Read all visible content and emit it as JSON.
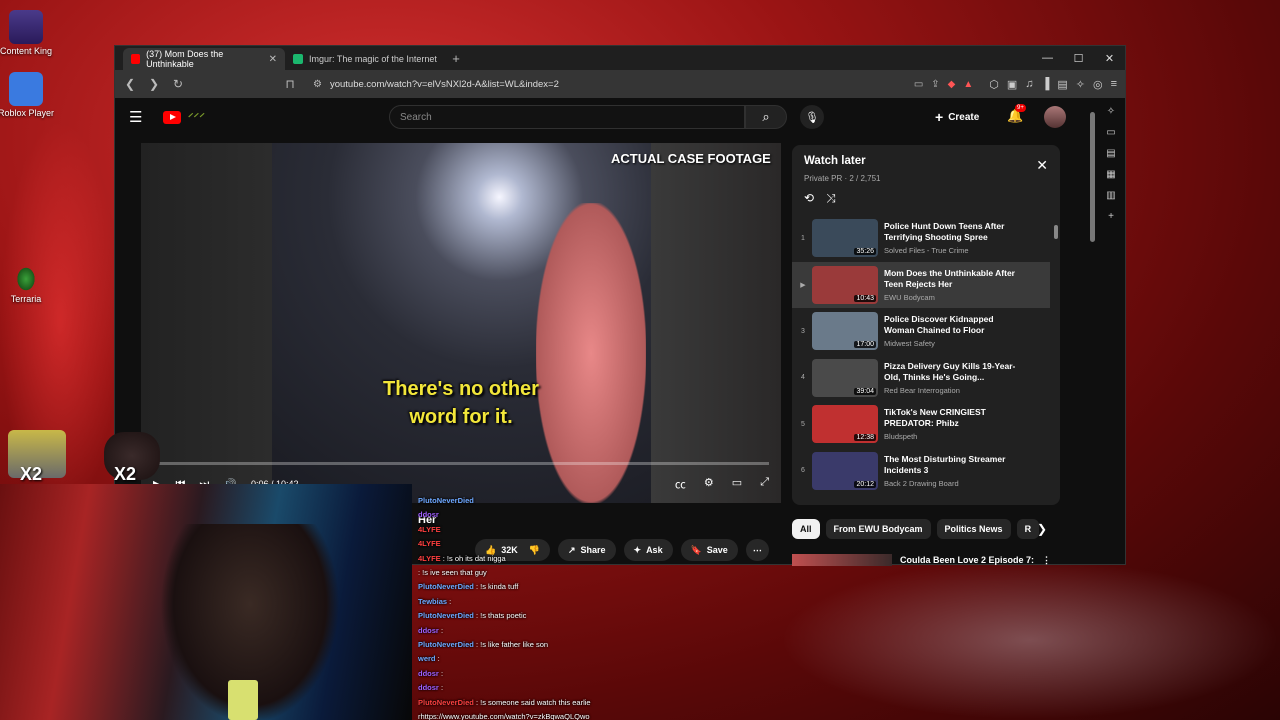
{
  "desktop": {
    "icons": [
      {
        "label": "Content King"
      },
      {
        "label": "Roblox Player"
      },
      {
        "label": "Terraria"
      }
    ]
  },
  "browser": {
    "tabs": [
      {
        "label": "(37) Mom Does the Unthinkable",
        "active": true
      },
      {
        "label": "Imgur: The magic of the Internet",
        "active": false
      }
    ],
    "url": "youtube.com/watch?v=elVsNXl2d-A&list=WL&index=2"
  },
  "youtube": {
    "search_placeholder": "Search",
    "create_label": "Create",
    "notif_count": "9+",
    "video": {
      "caption_line1": "There's no other",
      "caption_line2": "word for it.",
      "top_banner": "ACTUAL CASE FOOTAGE",
      "time": "0:06 / 10:42",
      "progress": 0.01
    },
    "actions": {
      "likes": "32K",
      "share": "Share",
      "ask": "Ask",
      "save": "Save"
    },
    "watch_later": {
      "title": "Watch later",
      "subtitle": "Private PR · 2 / 2,751",
      "items": [
        {
          "num": "1",
          "title": "Police Hunt Down Teens After Terrifying Shooting Spree",
          "channel": "Solved Files - True Crime",
          "duration": "35:26",
          "thumb": "#3a4a5a"
        },
        {
          "num": "▶",
          "title": "Mom Does the Unthinkable After Teen Rejects Her",
          "channel": "EWU Bodycam",
          "duration": "10:43",
          "thumb": "#9a3a3a"
        },
        {
          "num": "3",
          "title": "Police Discover Kidnapped Woman Chained to Floor",
          "channel": "Midwest Safety",
          "duration": "17:00",
          "thumb": "#6a7a8a"
        },
        {
          "num": "4",
          "title": "Pizza Delivery Guy Kills 19-Year-Old, Thinks He's Going...",
          "channel": "Red Bear Interrogation",
          "duration": "39:04",
          "thumb": "#4a4a4a"
        },
        {
          "num": "5",
          "title": "TikTok's New CRINGIEST PREDATOR: Phibz",
          "channel": "Bludspeth",
          "duration": "12:38",
          "thumb": "#c03030"
        },
        {
          "num": "6",
          "title": "The Most Disturbing Streamer Incidents 3",
          "channel": "Back 2 Drawing Board",
          "duration": "20:12",
          "thumb": "#3a3a6a"
        }
      ]
    },
    "chips": [
      "All",
      "From EWU Bodycam",
      "Politics News",
      "R"
    ],
    "next_video_title": "Coulda Been Love 2 Episode 7:"
  },
  "overlay": {
    "x2_left": "X2",
    "x2_right": "X2",
    "her_text": "Her"
  },
  "chat": [
    {
      "user": "PlutoNeverDied",
      "cls": "",
      "msg": ""
    },
    {
      "user": "ddosr",
      "cls": "purple",
      "msg": ""
    },
    {
      "user": "4LYFE",
      "cls": "red",
      "msg": ""
    },
    {
      "user": "4LYFE",
      "cls": "red",
      "msg": ""
    },
    {
      "user": "4LYFE",
      "cls": "red",
      "msg": ": !s oh its dat nigga"
    },
    {
      "user": "",
      "cls": "red",
      "msg": ": !s ive seen that guy"
    },
    {
      "user": "PlutoNeverDied",
      "cls": "",
      "msg": ": !s kinda tuff"
    },
    {
      "user": "Tewbias",
      "cls": "",
      "msg": ":"
    },
    {
      "user": "PlutoNeverDied",
      "cls": "",
      "msg": ": !s thats poetic"
    },
    {
      "user": "ddosr",
      "cls": "purple",
      "msg": ":"
    },
    {
      "user": "PlutoNeverDied",
      "cls": "",
      "msg": ": !s like father like son"
    },
    {
      "user": "werd",
      "cls": "",
      "msg": ":"
    },
    {
      "user": "ddosr",
      "cls": "purple",
      "msg": ":"
    },
    {
      "user": "ddosr",
      "cls": "purple",
      "msg": ":"
    },
    {
      "user": "PlutoNeverDied",
      "cls": "red",
      "msg": ": !s someone said watch this earlie"
    },
    {
      "user": "",
      "cls": "",
      "msg": "rhttps://www.youtube.com/watch?v=zkBqwaQLQwo"
    }
  ]
}
